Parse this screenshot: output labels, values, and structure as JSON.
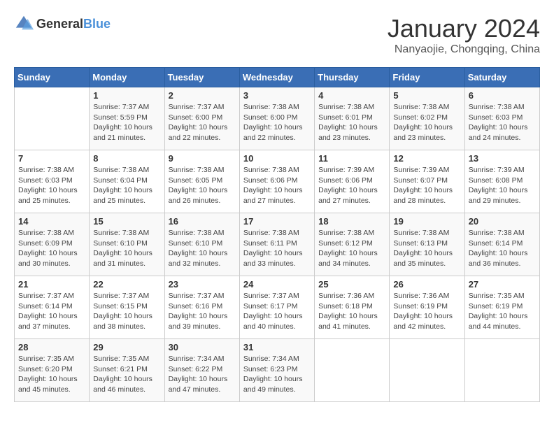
{
  "header": {
    "logo_general": "General",
    "logo_blue": "Blue",
    "title": "January 2024",
    "subtitle": "Nanyaojie, Chongqing, China"
  },
  "days_of_week": [
    "Sunday",
    "Monday",
    "Tuesday",
    "Wednesday",
    "Thursday",
    "Friday",
    "Saturday"
  ],
  "weeks": [
    [
      {
        "day": "",
        "sunrise": "",
        "sunset": "",
        "daylight": ""
      },
      {
        "day": "1",
        "sunrise": "Sunrise: 7:37 AM",
        "sunset": "Sunset: 5:59 PM",
        "daylight": "Daylight: 10 hours and 21 minutes."
      },
      {
        "day": "2",
        "sunrise": "Sunrise: 7:37 AM",
        "sunset": "Sunset: 6:00 PM",
        "daylight": "Daylight: 10 hours and 22 minutes."
      },
      {
        "day": "3",
        "sunrise": "Sunrise: 7:38 AM",
        "sunset": "Sunset: 6:00 PM",
        "daylight": "Daylight: 10 hours and 22 minutes."
      },
      {
        "day": "4",
        "sunrise": "Sunrise: 7:38 AM",
        "sunset": "Sunset: 6:01 PM",
        "daylight": "Daylight: 10 hours and 23 minutes."
      },
      {
        "day": "5",
        "sunrise": "Sunrise: 7:38 AM",
        "sunset": "Sunset: 6:02 PM",
        "daylight": "Daylight: 10 hours and 23 minutes."
      },
      {
        "day": "6",
        "sunrise": "Sunrise: 7:38 AM",
        "sunset": "Sunset: 6:03 PM",
        "daylight": "Daylight: 10 hours and 24 minutes."
      }
    ],
    [
      {
        "day": "7",
        "sunrise": "Sunrise: 7:38 AM",
        "sunset": "Sunset: 6:03 PM",
        "daylight": "Daylight: 10 hours and 25 minutes."
      },
      {
        "day": "8",
        "sunrise": "Sunrise: 7:38 AM",
        "sunset": "Sunset: 6:04 PM",
        "daylight": "Daylight: 10 hours and 25 minutes."
      },
      {
        "day": "9",
        "sunrise": "Sunrise: 7:38 AM",
        "sunset": "Sunset: 6:05 PM",
        "daylight": "Daylight: 10 hours and 26 minutes."
      },
      {
        "day": "10",
        "sunrise": "Sunrise: 7:38 AM",
        "sunset": "Sunset: 6:06 PM",
        "daylight": "Daylight: 10 hours and 27 minutes."
      },
      {
        "day": "11",
        "sunrise": "Sunrise: 7:39 AM",
        "sunset": "Sunset: 6:06 PM",
        "daylight": "Daylight: 10 hours and 27 minutes."
      },
      {
        "day": "12",
        "sunrise": "Sunrise: 7:39 AM",
        "sunset": "Sunset: 6:07 PM",
        "daylight": "Daylight: 10 hours and 28 minutes."
      },
      {
        "day": "13",
        "sunrise": "Sunrise: 7:39 AM",
        "sunset": "Sunset: 6:08 PM",
        "daylight": "Daylight: 10 hours and 29 minutes."
      }
    ],
    [
      {
        "day": "14",
        "sunrise": "Sunrise: 7:38 AM",
        "sunset": "Sunset: 6:09 PM",
        "daylight": "Daylight: 10 hours and 30 minutes."
      },
      {
        "day": "15",
        "sunrise": "Sunrise: 7:38 AM",
        "sunset": "Sunset: 6:10 PM",
        "daylight": "Daylight: 10 hours and 31 minutes."
      },
      {
        "day": "16",
        "sunrise": "Sunrise: 7:38 AM",
        "sunset": "Sunset: 6:10 PM",
        "daylight": "Daylight: 10 hours and 32 minutes."
      },
      {
        "day": "17",
        "sunrise": "Sunrise: 7:38 AM",
        "sunset": "Sunset: 6:11 PM",
        "daylight": "Daylight: 10 hours and 33 minutes."
      },
      {
        "day": "18",
        "sunrise": "Sunrise: 7:38 AM",
        "sunset": "Sunset: 6:12 PM",
        "daylight": "Daylight: 10 hours and 34 minutes."
      },
      {
        "day": "19",
        "sunrise": "Sunrise: 7:38 AM",
        "sunset": "Sunset: 6:13 PM",
        "daylight": "Daylight: 10 hours and 35 minutes."
      },
      {
        "day": "20",
        "sunrise": "Sunrise: 7:38 AM",
        "sunset": "Sunset: 6:14 PM",
        "daylight": "Daylight: 10 hours and 36 minutes."
      }
    ],
    [
      {
        "day": "21",
        "sunrise": "Sunrise: 7:37 AM",
        "sunset": "Sunset: 6:14 PM",
        "daylight": "Daylight: 10 hours and 37 minutes."
      },
      {
        "day": "22",
        "sunrise": "Sunrise: 7:37 AM",
        "sunset": "Sunset: 6:15 PM",
        "daylight": "Daylight: 10 hours and 38 minutes."
      },
      {
        "day": "23",
        "sunrise": "Sunrise: 7:37 AM",
        "sunset": "Sunset: 6:16 PM",
        "daylight": "Daylight: 10 hours and 39 minutes."
      },
      {
        "day": "24",
        "sunrise": "Sunrise: 7:37 AM",
        "sunset": "Sunset: 6:17 PM",
        "daylight": "Daylight: 10 hours and 40 minutes."
      },
      {
        "day": "25",
        "sunrise": "Sunrise: 7:36 AM",
        "sunset": "Sunset: 6:18 PM",
        "daylight": "Daylight: 10 hours and 41 minutes."
      },
      {
        "day": "26",
        "sunrise": "Sunrise: 7:36 AM",
        "sunset": "Sunset: 6:19 PM",
        "daylight": "Daylight: 10 hours and 42 minutes."
      },
      {
        "day": "27",
        "sunrise": "Sunrise: 7:35 AM",
        "sunset": "Sunset: 6:19 PM",
        "daylight": "Daylight: 10 hours and 44 minutes."
      }
    ],
    [
      {
        "day": "28",
        "sunrise": "Sunrise: 7:35 AM",
        "sunset": "Sunset: 6:20 PM",
        "daylight": "Daylight: 10 hours and 45 minutes."
      },
      {
        "day": "29",
        "sunrise": "Sunrise: 7:35 AM",
        "sunset": "Sunset: 6:21 PM",
        "daylight": "Daylight: 10 hours and 46 minutes."
      },
      {
        "day": "30",
        "sunrise": "Sunrise: 7:34 AM",
        "sunset": "Sunset: 6:22 PM",
        "daylight": "Daylight: 10 hours and 47 minutes."
      },
      {
        "day": "31",
        "sunrise": "Sunrise: 7:34 AM",
        "sunset": "Sunset: 6:23 PM",
        "daylight": "Daylight: 10 hours and 49 minutes."
      },
      {
        "day": "",
        "sunrise": "",
        "sunset": "",
        "daylight": ""
      },
      {
        "day": "",
        "sunrise": "",
        "sunset": "",
        "daylight": ""
      },
      {
        "day": "",
        "sunrise": "",
        "sunset": "",
        "daylight": ""
      }
    ]
  ]
}
